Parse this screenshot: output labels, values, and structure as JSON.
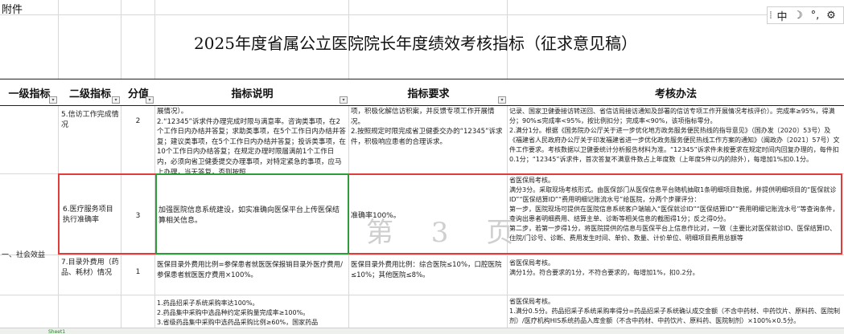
{
  "fujian": "附件",
  "title": "2025年度省属公立医院院长年度绩效考核指标（征求意见稿）",
  "headers": [
    "一级指标",
    "二级指标",
    "分值",
    "指标说明",
    "指标要求",
    "考核办法"
  ],
  "ime": {
    "mode_label": "中",
    "moon": "☽",
    "punct": "°,",
    "extra": "⚙"
  },
  "level1": "一、社会效益",
  "rows": [
    {
      "name": "5.信访工作完成情况",
      "score": "2",
      "desc": "展情况）。\n2.“12345”诉求件办理完成时限与满意率。咨询类事项，在2个工作日内办结并答复；求助类事项，在5个工作日内办结并答复；建议类事项，在5个工作日内办结并答复；投诉类事项，在10个工作日内办结答复；在规定办理时限届满前1个工作日内，必须向省卫健委提交办理事项，对特定紧急的事项，应马上办理，当天答复，否则按照",
      "req": "项，积极化解信访积案，并反馈专项工作开展情况。\n2.按照规定时限完成省卫健委交办的“12345”诉求件，积极响应患者的合理诉求。",
      "method": "记录、国家卫健委接访转送回、省信访局接访通知及部署的信访专项工作开展情况考核评价）。完成率≥95%，得满分；90%≤完成率<95%，按比例扣分；完成率<90%，该项指标零分。\n2.满分1分。根据《国务院办公厅关于进一步优化地方政务服务便民热线的指导意见》（国办发〔2020〕53号）及《福建省人民政府办公厅关于印发福建省进一步优化政务服务便民热线工作方案的通知》（闽政办〔2021〕57号）文件工作要求。考核数据以卫健委统计分析报告材料为准。“12345”诉求件未按要求在规定时间内回复办理的，每件扣0.1分；“12345”诉求件，首次答复不满意件数占上年度数（上年度5件以内的除外），每增加1%扣0.1分。"
    },
    {
      "name": "6.医疗服务项目执行准确率",
      "score": "3",
      "desc": "加强医院信息系统建设，如实准确向医保平台上传医保结算相关信息。",
      "req": "准确率100%。",
      "method": "省医保局考核。\n满分3分。采取现场考核形式。由医保部门从医保信息平台随机抽取1条明细项目数据，并提供明细项目的“医保就诊ID”“医保结算ID”“费用明细记账流水号”给医院，分两个步骤评分：\n第一步，医院现场可提供在医院信息系统客户端输入“医保就诊ID”“医保结算ID”“费用明细记账流水号”等查询条件，查询出患者明细费用、结算主单、诊断等相关信息的截图得1分；反之得0分。\n第二步，若第一步得1分，将医院提供的信息与医保平台上信息作比对，一致（主要比对医保就诊ID、医保结算ID、住院/门诊号、诊断、费用发生时间、单价、数量、计价单位、明细项目费用总额等"
    },
    {
      "name": "7.目录外费用（药品、耗材）情况",
      "score": "1",
      "desc": "医保目录外费用比例=参保患者就医医保报销目录外医疗费用/参保患者就医医疗费用×100%。",
      "req": "医保目录外费用比例：综合医院≤10%，口腔医院≤10%；其他医院≤8%。",
      "method": "省医保局考核。\n满分1分。符合要求的1分，不符合要求的，每增加1%，扣0.2分。"
    },
    {
      "name": "",
      "score": "",
      "desc": "1.药品招采子系统采购率达100%。\n2.药品集中采购中选品种约定采购量完成率≥100%。\n3.省级药品集中采购中选药品采购比例≥60%，国家药品",
      "req": "",
      "method": "省医保局考核。\n1.满分0.5分。药品招采子系统采购率得分=药品招采子系统确认成交金额（不含中药材、中药饮片、原料药、医院制剂）/医疗机构HIS系统药品入库金额（不含中药材、中药饮片、原料药、医院制剂）×100%×0.5分。"
    }
  ],
  "watermark": "第 3 页",
  "sheet_tab": "Sheet1"
}
